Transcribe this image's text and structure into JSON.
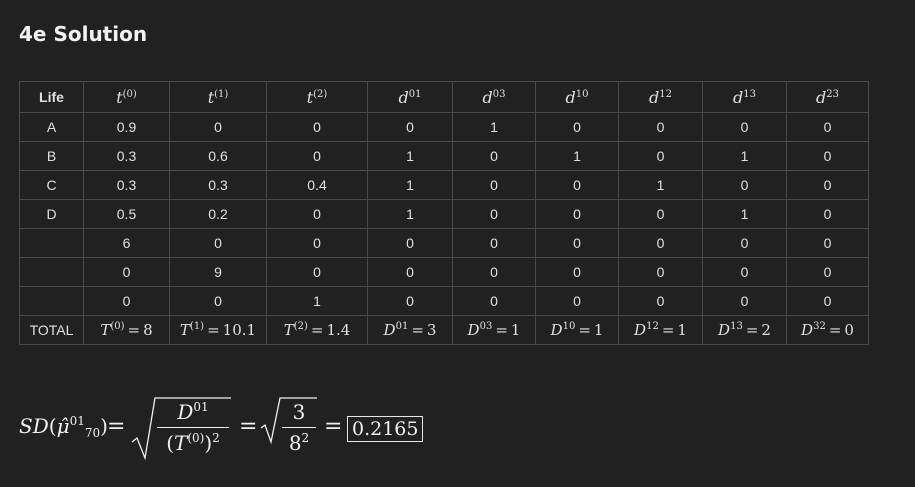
{
  "title": "4e Solution",
  "table": {
    "header_life": "Life",
    "columns": [
      {
        "base": "t",
        "sup": "(0)"
      },
      {
        "base": "t",
        "sup": "(1)"
      },
      {
        "base": "t",
        "sup": "(2)"
      },
      {
        "base": "d",
        "sup": "01"
      },
      {
        "base": "d",
        "sup": "03"
      },
      {
        "base": "d",
        "sup": "10"
      },
      {
        "base": "d",
        "sup": "12"
      },
      {
        "base": "d",
        "sup": "13"
      },
      {
        "base": "d",
        "sup": "23"
      }
    ],
    "rows": [
      {
        "life": "A",
        "cells": [
          "0.9",
          "0",
          "0",
          "0",
          "1",
          "0",
          "0",
          "0",
          "0"
        ]
      },
      {
        "life": "B",
        "cells": [
          "0.3",
          "0.6",
          "0",
          "1",
          "0",
          "1",
          "0",
          "1",
          "0"
        ]
      },
      {
        "life": "C",
        "cells": [
          "0.3",
          "0.3",
          "0.4",
          "1",
          "0",
          "0",
          "1",
          "0",
          "0"
        ]
      },
      {
        "life": "D",
        "cells": [
          "0.5",
          "0.2",
          "0",
          "1",
          "0",
          "0",
          "0",
          "1",
          "0"
        ]
      },
      {
        "life": "",
        "cells": [
          "6",
          "0",
          "0",
          "0",
          "0",
          "0",
          "0",
          "0",
          "0"
        ]
      },
      {
        "life": "",
        "cells": [
          "0",
          "9",
          "0",
          "0",
          "0",
          "0",
          "0",
          "0",
          "0"
        ]
      },
      {
        "life": "",
        "cells": [
          "0",
          "0",
          "1",
          "0",
          "0",
          "0",
          "0",
          "0",
          "0"
        ]
      }
    ],
    "total_label": "TOTAL",
    "totals": [
      {
        "base": "T",
        "sup": "(0)",
        "value": "8"
      },
      {
        "base": "T",
        "sup": "(1)",
        "value": "10.1"
      },
      {
        "base": "T",
        "sup": "(2)",
        "value": "1.4"
      },
      {
        "base": "D",
        "sup": "01",
        "value": "3"
      },
      {
        "base": "D",
        "sup": "03",
        "value": "1"
      },
      {
        "base": "D",
        "sup": "10",
        "value": "1"
      },
      {
        "base": "D",
        "sup": "12",
        "value": "1"
      },
      {
        "base": "D",
        "sup": "13",
        "value": "2"
      },
      {
        "base": "D",
        "sup": "32",
        "value": "0"
      }
    ]
  },
  "formula": {
    "lhs_func": "SD",
    "lhs_symbol": "μ̂",
    "lhs_sup": "01",
    "lhs_sub": "70",
    "frac1_num_base": "D",
    "frac1_num_sup": "01",
    "frac1_den_base": "T",
    "frac1_den_sup": "(0)",
    "frac1_den_pow": "2",
    "frac2_num": "3",
    "frac2_den_base": "8",
    "frac2_den_pow": "2",
    "result": "0.2165"
  }
}
